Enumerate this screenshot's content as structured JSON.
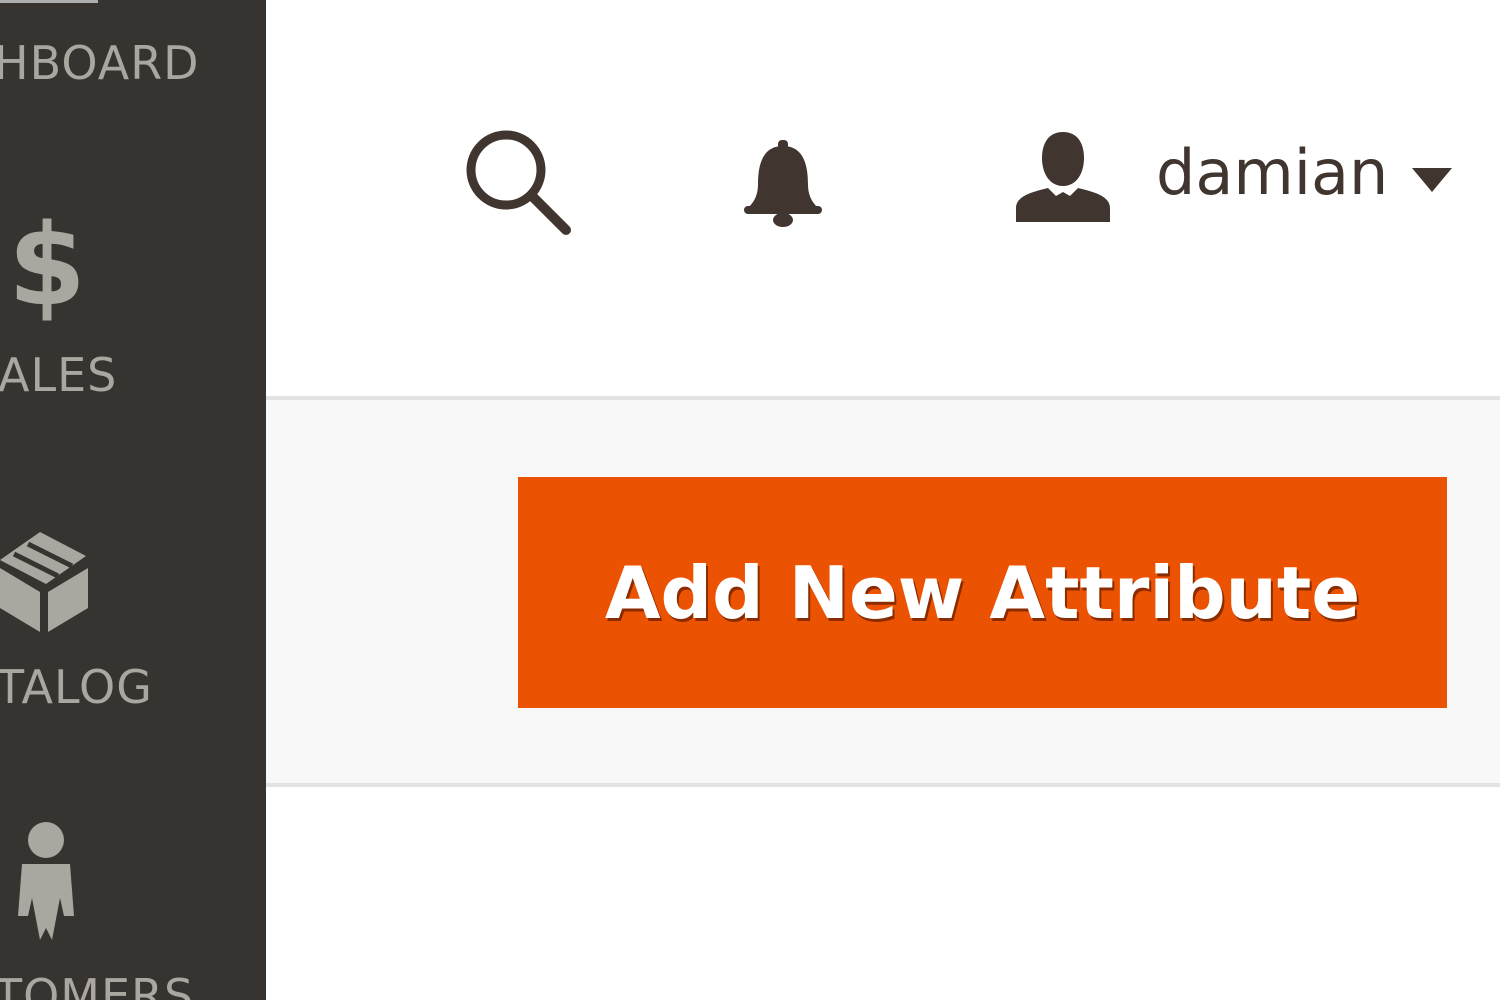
{
  "sidebar": {
    "items": [
      {
        "label": "HBOARD",
        "icon": "dashboard-icon"
      },
      {
        "label": "ALES",
        "icon": "dollar-icon",
        "glyph": "$"
      },
      {
        "label": "TALOG",
        "icon": "box-icon"
      },
      {
        "label": "TOMERS",
        "icon": "person-icon"
      }
    ]
  },
  "header": {
    "search_icon": "search-icon",
    "notifications_icon": "bell-icon",
    "user": {
      "name": "damian",
      "icon": "user-avatar-icon",
      "dropdown_icon": "caret-down-icon"
    }
  },
  "actions": {
    "add_button_label": "Add New Attribute"
  },
  "colors": {
    "sidebar_bg": "#373330",
    "sidebar_text": "#aaa6a0",
    "header_icon": "#41362f",
    "accent": "#eb5202",
    "action_bar_bg": "#f8f8f8"
  }
}
